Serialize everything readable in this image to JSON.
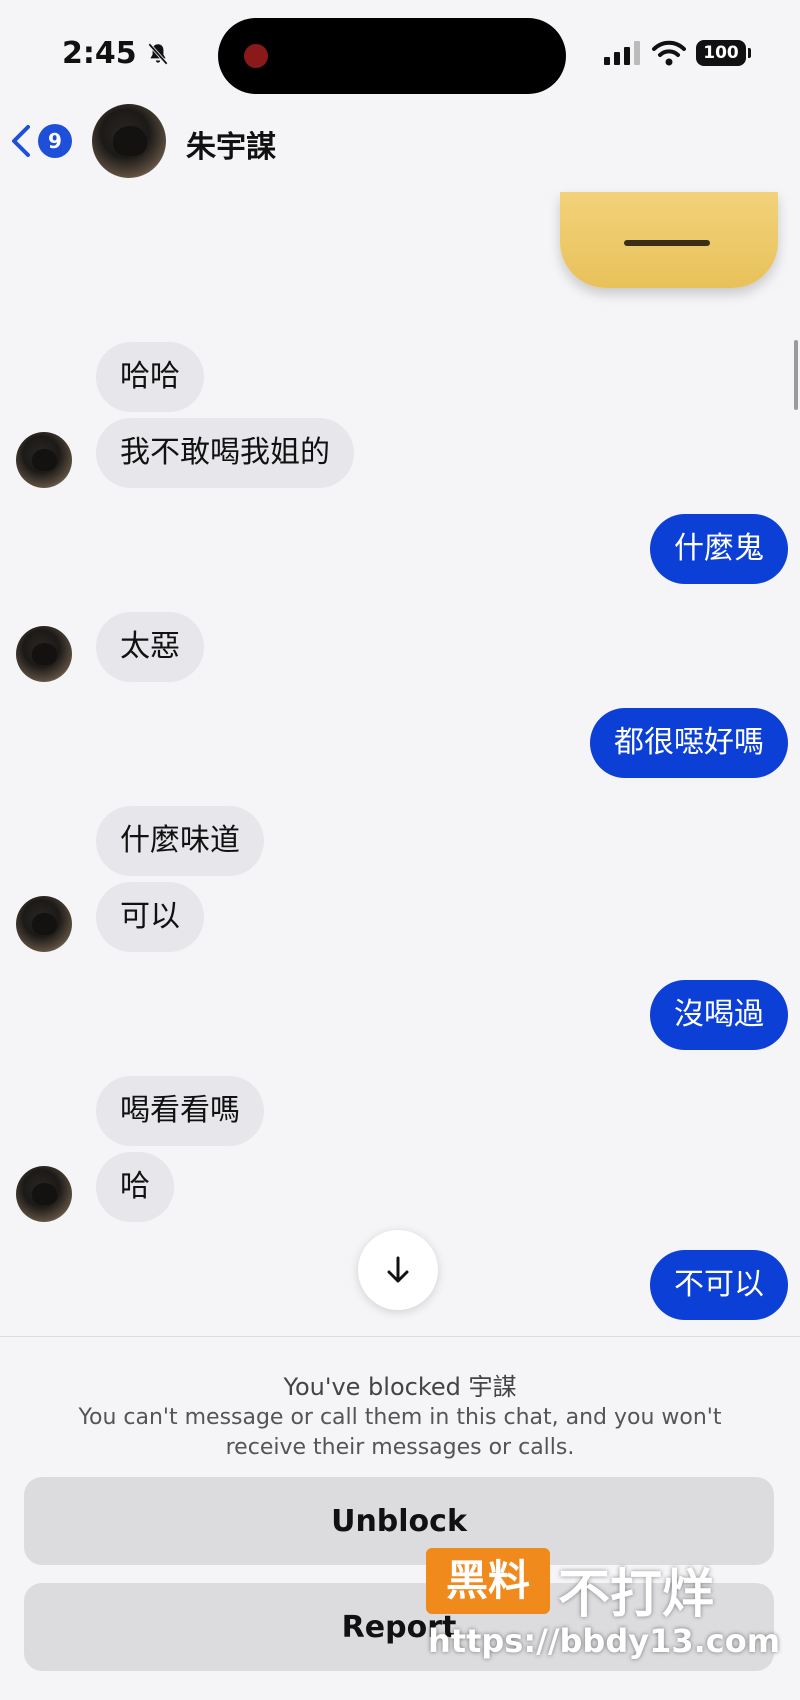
{
  "status_bar": {
    "time": "2:45",
    "battery": "100",
    "icons": [
      "bell-slash-icon",
      "signal-icon",
      "wifi-icon",
      "battery-icon"
    ]
  },
  "header": {
    "back_badge": "9",
    "contact_name": "朱宇謀"
  },
  "messages": [
    {
      "side": "in",
      "text": "哈哈"
    },
    {
      "side": "in",
      "text": "我不敢喝我姐的"
    },
    {
      "side": "out",
      "text": "什麼鬼"
    },
    {
      "side": "in",
      "text": "太惡"
    },
    {
      "side": "out",
      "text": "都很噁好嗎"
    },
    {
      "side": "in",
      "text": "什麼味道"
    },
    {
      "side": "in",
      "text": "可以"
    },
    {
      "side": "out",
      "text": "沒喝過"
    },
    {
      "side": "in",
      "text": "喝看看嗎"
    },
    {
      "side": "in",
      "text": "哈"
    },
    {
      "side": "out",
      "text": "不可以"
    }
  ],
  "blocked": {
    "title": "You've blocked 宇謀",
    "description": "You can't message or call them in this chat, and you won't receive their messages or calls.",
    "unblock_label": "Unblock",
    "report_label": "Report"
  },
  "watermark": {
    "badge": "黑料",
    "text": "不打烊",
    "url": "https://bbdy13.com"
  },
  "colors": {
    "outgoing_bubble": "#0c3fd6",
    "incoming_bubble": "#e7e7eb",
    "badge": "#1d4fd8",
    "watermark_badge": "#f08a1c"
  }
}
